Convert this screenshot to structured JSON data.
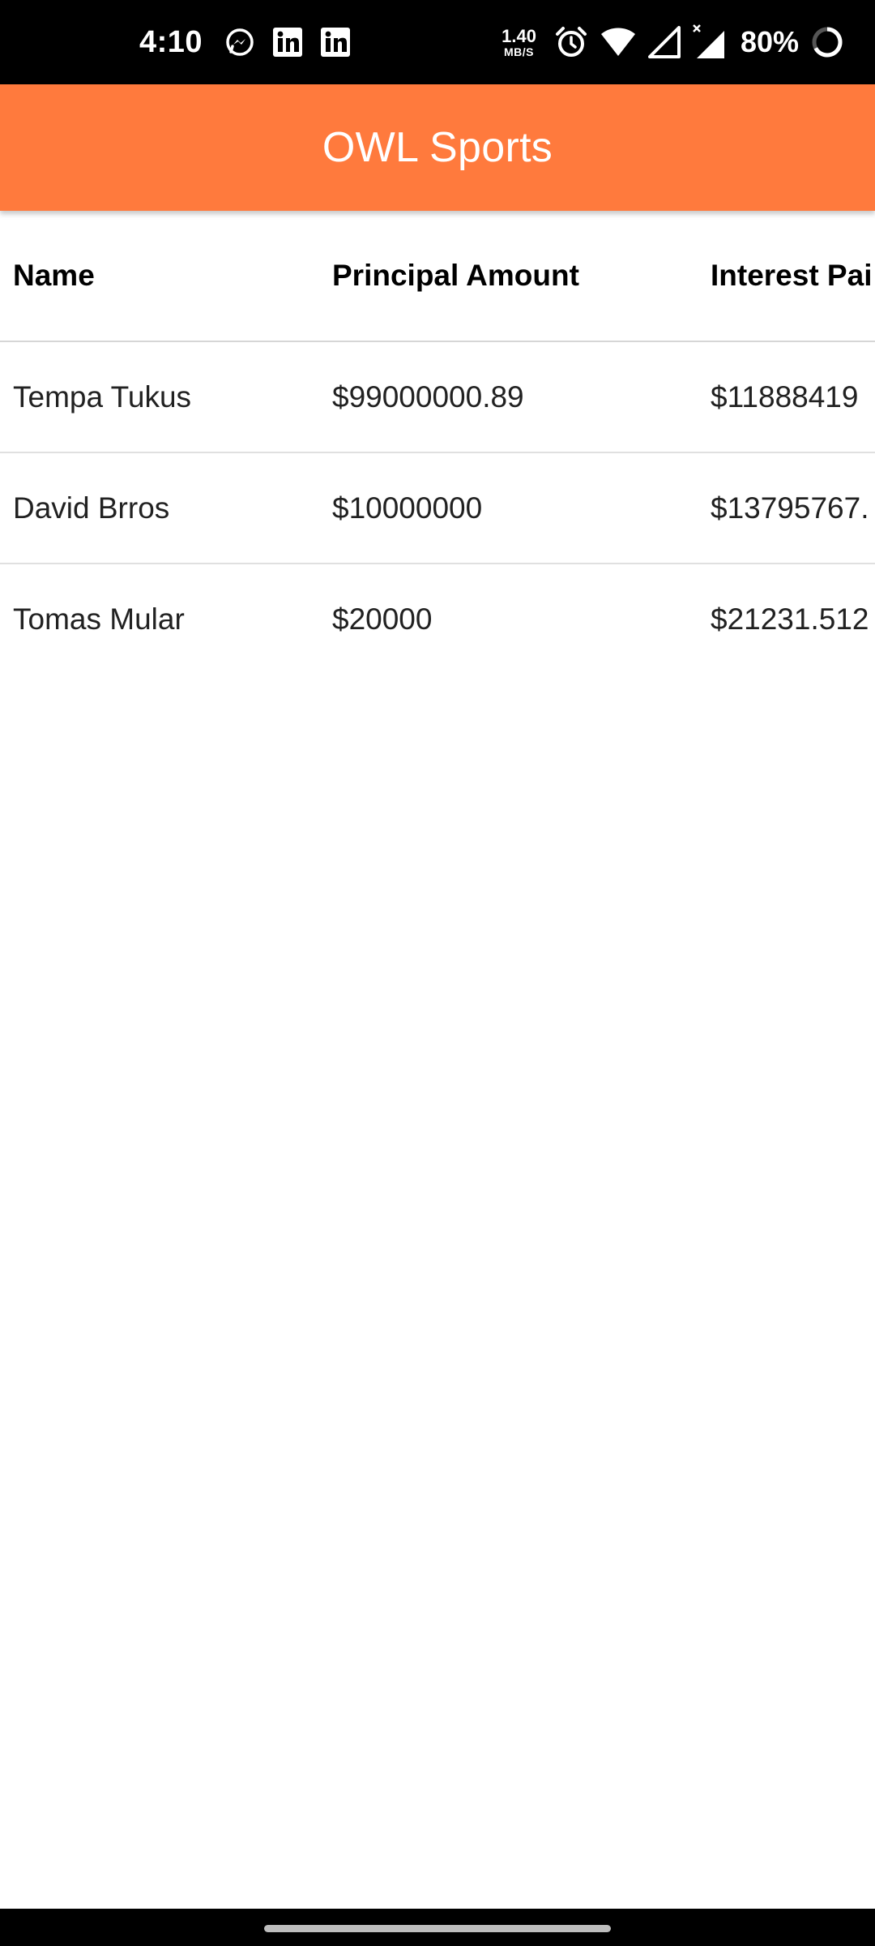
{
  "status_bar": {
    "time": "4:10",
    "net_speed_value": "1.40",
    "net_speed_unit": "MB/S",
    "battery_percent": "80%",
    "notification_icons": [
      "messenger-icon",
      "linkedin-icon",
      "linkedin-icon"
    ],
    "system_icons": [
      "alarm-icon",
      "wifi-icon",
      "signal-icon",
      "signal-x-icon",
      "battery-ring-icon"
    ]
  },
  "app_bar": {
    "title": "OWL Sports",
    "color": "#ff7a3d"
  },
  "table": {
    "columns": [
      "Name",
      "Principal Amount",
      "Interest Pai"
    ],
    "rows": [
      [
        "Tempa Tukus",
        "$99000000.89",
        "$11888419"
      ],
      [
        "David Brros",
        "$10000000",
        "$13795767."
      ],
      [
        "Tomas Mular",
        "$20000",
        "$21231.512"
      ]
    ]
  }
}
